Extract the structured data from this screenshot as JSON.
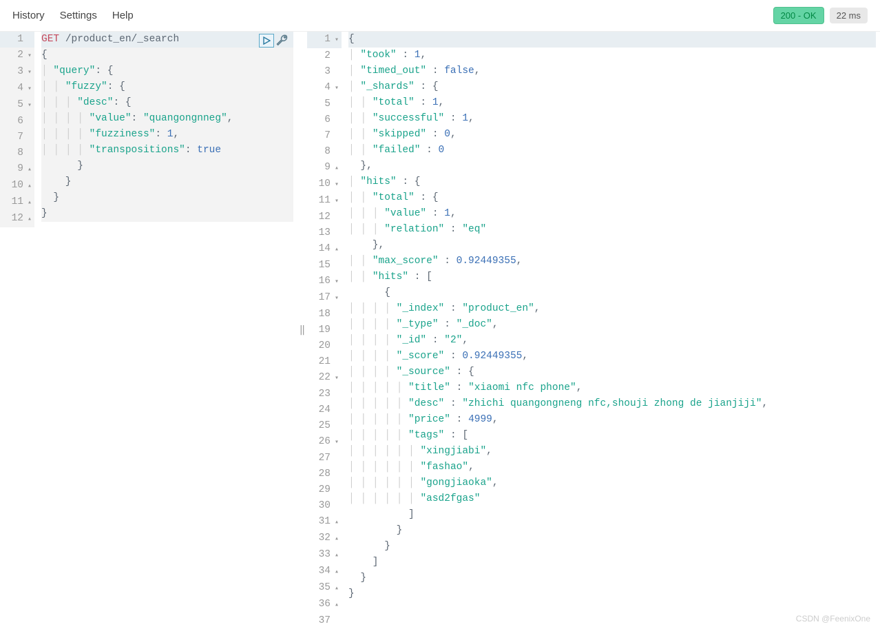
{
  "menu": {
    "history": "History",
    "settings": "Settings",
    "help": "Help"
  },
  "status": {
    "label": "200 - OK",
    "time": "22 ms"
  },
  "watermark": "CSDN @FeenixOne",
  "request": {
    "method": "GET",
    "path": "/product_en/_search",
    "body": {
      "query": {
        "fuzzy": {
          "desc": {
            "value": "quangongnneg",
            "fuzziness": 1,
            "transpositions": true
          }
        }
      }
    },
    "lines": [
      {
        "n": 1,
        "fold": "",
        "hl": true,
        "tokens": [
          {
            "t": "GET",
            "c": "method"
          },
          {
            "t": " ",
            "c": "punc"
          },
          {
            "t": "/product_en/_search",
            "c": "path"
          }
        ]
      },
      {
        "n": 2,
        "fold": "▾",
        "tokens": [
          {
            "t": "{",
            "c": "punc"
          }
        ]
      },
      {
        "n": 3,
        "fold": "▾",
        "tokens": [
          {
            "t": "  ",
            "c": "punc"
          },
          {
            "t": "\"query\"",
            "c": "key"
          },
          {
            "t": ": {",
            "c": "punc"
          }
        ]
      },
      {
        "n": 4,
        "fold": "▾",
        "tokens": [
          {
            "t": "    ",
            "c": "punc"
          },
          {
            "t": "\"fuzzy\"",
            "c": "key"
          },
          {
            "t": ": {",
            "c": "punc"
          }
        ]
      },
      {
        "n": 5,
        "fold": "▾",
        "tokens": [
          {
            "t": "      ",
            "c": "punc"
          },
          {
            "t": "\"desc\"",
            "c": "key"
          },
          {
            "t": ": {",
            "c": "punc"
          }
        ]
      },
      {
        "n": 6,
        "fold": "",
        "tokens": [
          {
            "t": "        ",
            "c": "punc"
          },
          {
            "t": "\"value\"",
            "c": "key"
          },
          {
            "t": ": ",
            "c": "punc"
          },
          {
            "t": "\"quangongnneg\"",
            "c": "str"
          },
          {
            "t": ",",
            "c": "punc"
          }
        ]
      },
      {
        "n": 7,
        "fold": "",
        "tokens": [
          {
            "t": "        ",
            "c": "punc"
          },
          {
            "t": "\"fuzziness\"",
            "c": "key"
          },
          {
            "t": ": ",
            "c": "punc"
          },
          {
            "t": "1",
            "c": "num"
          },
          {
            "t": ",",
            "c": "punc"
          }
        ]
      },
      {
        "n": 8,
        "fold": "",
        "tokens": [
          {
            "t": "        ",
            "c": "punc"
          },
          {
            "t": "\"transpositions\"",
            "c": "key"
          },
          {
            "t": ": ",
            "c": "punc"
          },
          {
            "t": "true",
            "c": "bool"
          }
        ]
      },
      {
        "n": 9,
        "fold": "▴",
        "tokens": [
          {
            "t": "      }",
            "c": "punc"
          }
        ]
      },
      {
        "n": 10,
        "fold": "▴",
        "tokens": [
          {
            "t": "    }",
            "c": "punc"
          }
        ]
      },
      {
        "n": 11,
        "fold": "▴",
        "tokens": [
          {
            "t": "  }",
            "c": "punc"
          }
        ]
      },
      {
        "n": 12,
        "fold": "▴",
        "tokens": [
          {
            "t": "}",
            "c": "punc"
          }
        ]
      }
    ]
  },
  "response": {
    "json": {
      "took": 1,
      "timed_out": false,
      "_shards": {
        "total": 1,
        "successful": 1,
        "skipped": 0,
        "failed": 0
      },
      "hits": {
        "total": {
          "value": 1,
          "relation": "eq"
        },
        "max_score": 0.92449355,
        "hits": [
          {
            "_index": "product_en",
            "_type": "_doc",
            "_id": "2",
            "_score": 0.92449355,
            "_source": {
              "title": "xiaomi nfc phone",
              "desc": "zhichi quangongneng nfc,shouji zhong de jianjiji",
              "price": 4999,
              "tags": [
                "xingjiabi",
                "fashao",
                "gongjiaoka",
                "asd2fgas"
              ]
            }
          }
        ]
      }
    },
    "lines": [
      {
        "n": 1,
        "fold": "▾",
        "hl": true,
        "tokens": [
          {
            "t": "{",
            "c": "punc"
          }
        ]
      },
      {
        "n": 2,
        "fold": "",
        "tokens": [
          {
            "t": "  ",
            "c": "punc"
          },
          {
            "t": "\"took\"",
            "c": "key"
          },
          {
            "t": " : ",
            "c": "punc"
          },
          {
            "t": "1",
            "c": "num"
          },
          {
            "t": ",",
            "c": "punc"
          }
        ]
      },
      {
        "n": 3,
        "fold": "",
        "tokens": [
          {
            "t": "  ",
            "c": "punc"
          },
          {
            "t": "\"timed_out\"",
            "c": "key"
          },
          {
            "t": " : ",
            "c": "punc"
          },
          {
            "t": "false",
            "c": "bool"
          },
          {
            "t": ",",
            "c": "punc"
          }
        ]
      },
      {
        "n": 4,
        "fold": "▾",
        "tokens": [
          {
            "t": "  ",
            "c": "punc"
          },
          {
            "t": "\"_shards\"",
            "c": "key"
          },
          {
            "t": " : {",
            "c": "punc"
          }
        ]
      },
      {
        "n": 5,
        "fold": "",
        "tokens": [
          {
            "t": "    ",
            "c": "punc"
          },
          {
            "t": "\"total\"",
            "c": "key"
          },
          {
            "t": " : ",
            "c": "punc"
          },
          {
            "t": "1",
            "c": "num"
          },
          {
            "t": ",",
            "c": "punc"
          }
        ]
      },
      {
        "n": 6,
        "fold": "",
        "tokens": [
          {
            "t": "    ",
            "c": "punc"
          },
          {
            "t": "\"successful\"",
            "c": "key"
          },
          {
            "t": " : ",
            "c": "punc"
          },
          {
            "t": "1",
            "c": "num"
          },
          {
            "t": ",",
            "c": "punc"
          }
        ]
      },
      {
        "n": 7,
        "fold": "",
        "tokens": [
          {
            "t": "    ",
            "c": "punc"
          },
          {
            "t": "\"skipped\"",
            "c": "key"
          },
          {
            "t": " : ",
            "c": "punc"
          },
          {
            "t": "0",
            "c": "num"
          },
          {
            "t": ",",
            "c": "punc"
          }
        ]
      },
      {
        "n": 8,
        "fold": "",
        "tokens": [
          {
            "t": "    ",
            "c": "punc"
          },
          {
            "t": "\"failed\"",
            "c": "key"
          },
          {
            "t": " : ",
            "c": "punc"
          },
          {
            "t": "0",
            "c": "num"
          }
        ]
      },
      {
        "n": 9,
        "fold": "▴",
        "tokens": [
          {
            "t": "  },",
            "c": "punc"
          }
        ]
      },
      {
        "n": 10,
        "fold": "▾",
        "tokens": [
          {
            "t": "  ",
            "c": "punc"
          },
          {
            "t": "\"hits\"",
            "c": "key"
          },
          {
            "t": " : {",
            "c": "punc"
          }
        ]
      },
      {
        "n": 11,
        "fold": "▾",
        "tokens": [
          {
            "t": "    ",
            "c": "punc"
          },
          {
            "t": "\"total\"",
            "c": "key"
          },
          {
            "t": " : {",
            "c": "punc"
          }
        ]
      },
      {
        "n": 12,
        "fold": "",
        "tokens": [
          {
            "t": "      ",
            "c": "punc"
          },
          {
            "t": "\"value\"",
            "c": "key"
          },
          {
            "t": " : ",
            "c": "punc"
          },
          {
            "t": "1",
            "c": "num"
          },
          {
            "t": ",",
            "c": "punc"
          }
        ]
      },
      {
        "n": 13,
        "fold": "",
        "tokens": [
          {
            "t": "      ",
            "c": "punc"
          },
          {
            "t": "\"relation\"",
            "c": "key"
          },
          {
            "t": " : ",
            "c": "punc"
          },
          {
            "t": "\"eq\"",
            "c": "str"
          }
        ]
      },
      {
        "n": 14,
        "fold": "▴",
        "tokens": [
          {
            "t": "    },",
            "c": "punc"
          }
        ]
      },
      {
        "n": 15,
        "fold": "",
        "tokens": [
          {
            "t": "    ",
            "c": "punc"
          },
          {
            "t": "\"max_score\"",
            "c": "key"
          },
          {
            "t": " : ",
            "c": "punc"
          },
          {
            "t": "0.92449355",
            "c": "num"
          },
          {
            "t": ",",
            "c": "punc"
          }
        ]
      },
      {
        "n": 16,
        "fold": "▾",
        "tokens": [
          {
            "t": "    ",
            "c": "punc"
          },
          {
            "t": "\"hits\"",
            "c": "key"
          },
          {
            "t": " : [",
            "c": "punc"
          }
        ]
      },
      {
        "n": 17,
        "fold": "▾",
        "tokens": [
          {
            "t": "      {",
            "c": "punc"
          }
        ]
      },
      {
        "n": 18,
        "fold": "",
        "tokens": [
          {
            "t": "        ",
            "c": "punc"
          },
          {
            "t": "\"_index\"",
            "c": "key"
          },
          {
            "t": " : ",
            "c": "punc"
          },
          {
            "t": "\"product_en\"",
            "c": "str"
          },
          {
            "t": ",",
            "c": "punc"
          }
        ]
      },
      {
        "n": 19,
        "fold": "",
        "tokens": [
          {
            "t": "        ",
            "c": "punc"
          },
          {
            "t": "\"_type\"",
            "c": "key"
          },
          {
            "t": " : ",
            "c": "punc"
          },
          {
            "t": "\"_doc\"",
            "c": "str"
          },
          {
            "t": ",",
            "c": "punc"
          }
        ]
      },
      {
        "n": 20,
        "fold": "",
        "tokens": [
          {
            "t": "        ",
            "c": "punc"
          },
          {
            "t": "\"_id\"",
            "c": "key"
          },
          {
            "t": " : ",
            "c": "punc"
          },
          {
            "t": "\"2\"",
            "c": "str"
          },
          {
            "t": ",",
            "c": "punc"
          }
        ]
      },
      {
        "n": 21,
        "fold": "",
        "tokens": [
          {
            "t": "        ",
            "c": "punc"
          },
          {
            "t": "\"_score\"",
            "c": "key"
          },
          {
            "t": " : ",
            "c": "punc"
          },
          {
            "t": "0.92449355",
            "c": "num"
          },
          {
            "t": ",",
            "c": "punc"
          }
        ]
      },
      {
        "n": 22,
        "fold": "▾",
        "tokens": [
          {
            "t": "        ",
            "c": "punc"
          },
          {
            "t": "\"_source\"",
            "c": "key"
          },
          {
            "t": " : {",
            "c": "punc"
          }
        ]
      },
      {
        "n": 23,
        "fold": "",
        "tokens": [
          {
            "t": "          ",
            "c": "punc"
          },
          {
            "t": "\"title\"",
            "c": "key"
          },
          {
            "t": " : ",
            "c": "punc"
          },
          {
            "t": "\"xiaomi nfc phone\"",
            "c": "str"
          },
          {
            "t": ",",
            "c": "punc"
          }
        ]
      },
      {
        "n": 24,
        "fold": "",
        "tokens": [
          {
            "t": "          ",
            "c": "punc"
          },
          {
            "t": "\"desc\"",
            "c": "key"
          },
          {
            "t": " : ",
            "c": "punc"
          },
          {
            "t": "\"zhichi quangongneng nfc,shouji zhong de jianjiji\"",
            "c": "str"
          },
          {
            "t": ",",
            "c": "punc"
          }
        ]
      },
      {
        "n": 25,
        "fold": "",
        "tokens": [
          {
            "t": "          ",
            "c": "punc"
          },
          {
            "t": "\"price\"",
            "c": "key"
          },
          {
            "t": " : ",
            "c": "punc"
          },
          {
            "t": "4999",
            "c": "num"
          },
          {
            "t": ",",
            "c": "punc"
          }
        ]
      },
      {
        "n": 26,
        "fold": "▾",
        "tokens": [
          {
            "t": "          ",
            "c": "punc"
          },
          {
            "t": "\"tags\"",
            "c": "key"
          },
          {
            "t": " : [",
            "c": "punc"
          }
        ]
      },
      {
        "n": 27,
        "fold": "",
        "tokens": [
          {
            "t": "            ",
            "c": "punc"
          },
          {
            "t": "\"xingjiabi\"",
            "c": "str"
          },
          {
            "t": ",",
            "c": "punc"
          }
        ]
      },
      {
        "n": 28,
        "fold": "",
        "tokens": [
          {
            "t": "            ",
            "c": "punc"
          },
          {
            "t": "\"fashao\"",
            "c": "str"
          },
          {
            "t": ",",
            "c": "punc"
          }
        ]
      },
      {
        "n": 29,
        "fold": "",
        "tokens": [
          {
            "t": "            ",
            "c": "punc"
          },
          {
            "t": "\"gongjiaoka\"",
            "c": "str"
          },
          {
            "t": ",",
            "c": "punc"
          }
        ]
      },
      {
        "n": 30,
        "fold": "",
        "tokens": [
          {
            "t": "            ",
            "c": "punc"
          },
          {
            "t": "\"asd2fgas\"",
            "c": "str"
          }
        ]
      },
      {
        "n": 31,
        "fold": "▴",
        "tokens": [
          {
            "t": "          ]",
            "c": "punc"
          }
        ]
      },
      {
        "n": 32,
        "fold": "▴",
        "tokens": [
          {
            "t": "        }",
            "c": "punc"
          }
        ]
      },
      {
        "n": 33,
        "fold": "▴",
        "tokens": [
          {
            "t": "      }",
            "c": "punc"
          }
        ]
      },
      {
        "n": 34,
        "fold": "▴",
        "tokens": [
          {
            "t": "    ]",
            "c": "punc"
          }
        ]
      },
      {
        "n": 35,
        "fold": "▴",
        "tokens": [
          {
            "t": "  }",
            "c": "punc"
          }
        ]
      },
      {
        "n": 36,
        "fold": "▴",
        "tokens": [
          {
            "t": "}",
            "c": "punc"
          }
        ]
      },
      {
        "n": 37,
        "fold": "",
        "tokens": [
          {
            "t": "",
            "c": "punc"
          }
        ]
      }
    ]
  }
}
